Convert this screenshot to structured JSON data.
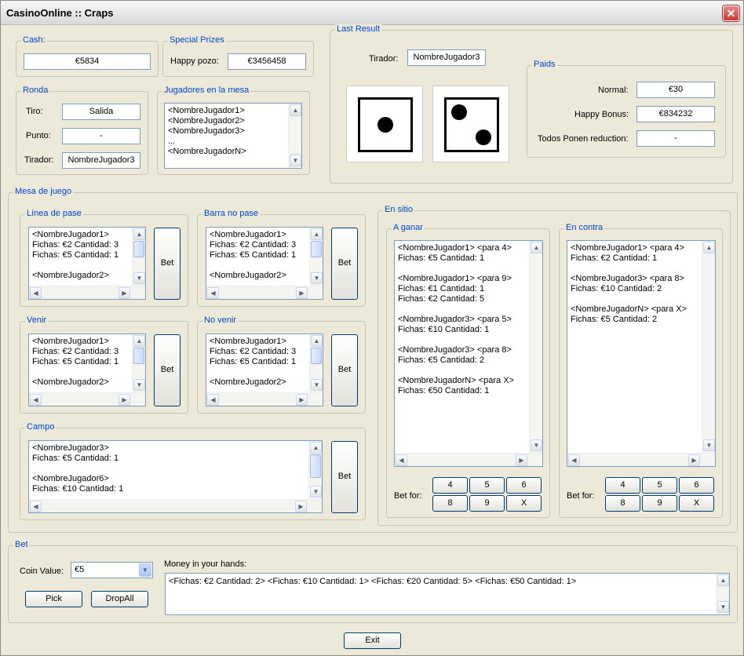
{
  "window": {
    "title": "CasinoOnline :: Craps",
    "close_label": "✕"
  },
  "cash": {
    "legend": "Cash:",
    "value": "€5834"
  },
  "special_prizes": {
    "legend": "Special Prizes",
    "happy_pozo_label": "Happy pozo:",
    "happy_pozo_value": "€3456458"
  },
  "ronda": {
    "legend": "Ronda",
    "tiro_label": "Tiro:",
    "tiro_value": "Salida",
    "punto_label": "Punto:",
    "punto_value": "-",
    "tirador_label": "Tirador:",
    "tirador_value": "NombreJugador3"
  },
  "jugadores": {
    "legend": "Jugadores en la mesa",
    "items": "<NombreJugador1>\n<NombreJugador2>\n<NombreJugador3>\n...\n<NombreJugadorN>"
  },
  "last_result": {
    "legend": "Last Result",
    "tirador_label": "Tirador:",
    "tirador_value": "NombreJugador3",
    "dice": [
      1,
      2
    ]
  },
  "paids": {
    "legend": "Paids",
    "normal_label": "Normal:",
    "normal_value": "€30",
    "happy_bonus_label": "Happy Bonus:",
    "happy_bonus_value": "€834232",
    "todos_label": "Todos Ponen reduction:",
    "todos_value": "-"
  },
  "mesa": {
    "legend": "Mesa de juego",
    "bet_label": "Bet",
    "linea_pase": {
      "legend": "Línea de pase",
      "items": "<NombreJugador1>\nFichas: €2 Cantidad: 3\nFichas: €5 Cantidad: 1\n\n<NombreJugador2>"
    },
    "barra_no_pase": {
      "legend": "Barra no pase",
      "items": "<NombreJugador1>\nFichas: €2 Cantidad: 3\nFichas: €5 Cantidad: 1\n\n<NombreJugador2>"
    },
    "venir": {
      "legend": "Venir",
      "items": "<NombreJugador1>\nFichas: €2 Cantidad: 3\nFichas: €5 Cantidad: 1\n\n<NombreJugador2>"
    },
    "no_venir": {
      "legend": "No venir",
      "items": "<NombreJugador1>\nFichas: €2 Cantidad: 3\nFichas: €5 Cantidad: 1\n\n<NombreJugador2>"
    },
    "campo": {
      "legend": "Campo",
      "items": "<NombreJugador3>\nFichas: €5 Cantidad: 1\n\n<NombreJugador6>\nFichas: €10 Cantidad: 1"
    }
  },
  "en_sitio": {
    "legend": "En sitio",
    "bet_for_label": "Bet for:",
    "numbers": [
      "4",
      "5",
      "6",
      "8",
      "9",
      "X"
    ],
    "a_ganar": {
      "legend": "A ganar",
      "items": "<NombreJugador1> <para 4>\nFichas: €5 Cantidad: 1\n\n<NombreJugador1> <para 9>\nFichas: €1 Cantidad: 1\nFichas: €2 Cantidad: 5\n\n<NombreJugador3> <para 5>\nFichas: €10 Cantidad: 1\n\n<NombreJugador3> <para 8>\nFichas: €5 Cantidad: 2\n\n<NombreJugadorN> <para X>\nFichas: €50 Cantidad: 1"
    },
    "en_contra": {
      "legend": "En contra",
      "items": "<NombreJugador1> <para 4>\nFichas: €2 Cantidad: 1\n\n<NombreJugador3> <para 8>\nFichas: €10 Cantidad: 2\n\n<NombreJugadorN> <para X>\nFichas: €5 Cantidad: 2"
    }
  },
  "bet": {
    "legend": "Bet",
    "coin_label": "Coin Value:",
    "coin_value": "€5",
    "pick_label": "Pick",
    "dropall_label": "DropAll",
    "money_label": "Money in your hands:",
    "money_value": "<Fichas: €2 Cantidad: 2> <Fichas: €10 Cantidad: 1> <Fichas: €20 Cantidad: 5> <Fichas: €50 Cantidad: 1>"
  },
  "exit_label": "Exit",
  "icons": {
    "scroll_up": "chevron-up-icon",
    "scroll_down": "chevron-down-icon",
    "scroll_left": "chevron-left-icon",
    "scroll_right": "chevron-right-icon",
    "close": "close-icon"
  },
  "colors": {
    "legend": "#0046d5",
    "background": "#ece9d8",
    "border": "#7f9db9"
  }
}
